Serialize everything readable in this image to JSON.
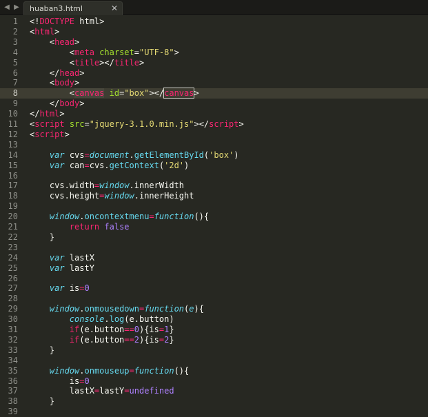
{
  "window": {
    "tab_title": "huaban3.html",
    "nav_back": "◀",
    "nav_forward": "▶",
    "close_glyph": "✕"
  },
  "editor": {
    "current_line": 8,
    "lines": [
      {
        "n": "1",
        "tokens": [
          [
            "t-plain",
            "<!"
          ],
          [
            "t-tag",
            "DOCTYPE"
          ],
          [
            "t-plain",
            " html>"
          ]
        ]
      },
      {
        "n": "2",
        "tokens": [
          [
            "t-plain",
            "<"
          ],
          [
            "t-tag",
            "html"
          ],
          [
            "t-plain",
            ">"
          ]
        ]
      },
      {
        "n": "3",
        "tokens": [
          [
            "t-plain",
            "    <"
          ],
          [
            "t-tag",
            "head"
          ],
          [
            "t-plain",
            ">"
          ]
        ]
      },
      {
        "n": "4",
        "tokens": [
          [
            "t-plain",
            "        <"
          ],
          [
            "t-tag",
            "meta"
          ],
          [
            "t-plain",
            " "
          ],
          [
            "t-attr",
            "charset"
          ],
          [
            "t-plain",
            "="
          ],
          [
            "t-str",
            "\"UTF-8\""
          ],
          [
            "t-plain",
            ">"
          ]
        ]
      },
      {
        "n": "5",
        "tokens": [
          [
            "t-plain",
            "        <"
          ],
          [
            "t-tag",
            "title"
          ],
          [
            "t-plain",
            "></"
          ],
          [
            "t-tag",
            "title"
          ],
          [
            "t-plain",
            ">"
          ]
        ]
      },
      {
        "n": "6",
        "tokens": [
          [
            "t-plain",
            "    </"
          ],
          [
            "t-tag",
            "head"
          ],
          [
            "t-plain",
            ">"
          ]
        ]
      },
      {
        "n": "7",
        "tokens": [
          [
            "t-plain",
            "    <"
          ],
          [
            "t-tag",
            "body"
          ],
          [
            "t-plain",
            ">"
          ]
        ]
      },
      {
        "n": "8",
        "tokens": [
          [
            "t-plain",
            "        <"
          ],
          [
            "t-tag boxfill",
            "canvas"
          ],
          [
            "t-plain",
            " "
          ],
          [
            "t-attr",
            "id"
          ],
          [
            "t-plain",
            "="
          ],
          [
            "t-str",
            "\"box\""
          ],
          [
            "t-plain",
            "></"
          ],
          [
            "t-tag box",
            "canvas"
          ],
          [
            "t-plain",
            ">"
          ]
        ]
      },
      {
        "n": "9",
        "tokens": [
          [
            "t-plain",
            "    </"
          ],
          [
            "t-tag",
            "body"
          ],
          [
            "t-plain",
            ">"
          ]
        ]
      },
      {
        "n": "10",
        "tokens": [
          [
            "t-plain",
            "</"
          ],
          [
            "t-tag",
            "html"
          ],
          [
            "t-plain",
            ">"
          ]
        ]
      },
      {
        "n": "11",
        "tokens": [
          [
            "t-plain",
            "<"
          ],
          [
            "t-tag",
            "script"
          ],
          [
            "t-plain",
            " "
          ],
          [
            "t-attr",
            "src"
          ],
          [
            "t-plain",
            "="
          ],
          [
            "t-str",
            "\"jquery-3.1.0.min.js\""
          ],
          [
            "t-plain",
            "></"
          ],
          [
            "t-tag",
            "script"
          ],
          [
            "t-plain",
            ">"
          ]
        ]
      },
      {
        "n": "12",
        "tokens": [
          [
            "t-plain",
            "<"
          ],
          [
            "t-tag",
            "script"
          ],
          [
            "t-plain",
            ">"
          ]
        ]
      },
      {
        "n": "13",
        "tokens": []
      },
      {
        "n": "14",
        "tokens": [
          [
            "t-plain",
            "    "
          ],
          [
            "t-kw",
            "var"
          ],
          [
            "t-plain",
            " cvs"
          ],
          [
            "t-op",
            "="
          ],
          [
            "t-kw",
            "document"
          ],
          [
            "t-plain",
            "."
          ],
          [
            "t-fn",
            "getElementById"
          ],
          [
            "t-plain",
            "("
          ],
          [
            "t-str",
            "'box'"
          ],
          [
            "t-plain",
            ")"
          ]
        ]
      },
      {
        "n": "15",
        "tokens": [
          [
            "t-plain",
            "    "
          ],
          [
            "t-kw",
            "var"
          ],
          [
            "t-plain",
            " can"
          ],
          [
            "t-op",
            "="
          ],
          [
            "t-plain",
            "cvs."
          ],
          [
            "t-fn",
            "getContext"
          ],
          [
            "t-plain",
            "("
          ],
          [
            "t-str",
            "'2d'"
          ],
          [
            "t-plain",
            ")"
          ]
        ]
      },
      {
        "n": "16",
        "tokens": []
      },
      {
        "n": "17",
        "tokens": [
          [
            "t-plain",
            "    cvs.width"
          ],
          [
            "t-op",
            "="
          ],
          [
            "t-kw",
            "window"
          ],
          [
            "t-plain",
            ".innerWidth"
          ]
        ]
      },
      {
        "n": "18",
        "tokens": [
          [
            "t-plain",
            "    cvs.height"
          ],
          [
            "t-op",
            "="
          ],
          [
            "t-kw",
            "window"
          ],
          [
            "t-plain",
            ".innerHeight"
          ]
        ]
      },
      {
        "n": "19",
        "tokens": []
      },
      {
        "n": "20",
        "tokens": [
          [
            "t-plain",
            "    "
          ],
          [
            "t-kw",
            "window"
          ],
          [
            "t-plain",
            "."
          ],
          [
            "t-fn",
            "oncontextmenu"
          ],
          [
            "t-op",
            "="
          ],
          [
            "t-kw",
            "function"
          ],
          [
            "t-plain",
            "(){"
          ]
        ]
      },
      {
        "n": "21",
        "tokens": [
          [
            "t-plain",
            "        "
          ],
          [
            "t-op",
            "return"
          ],
          [
            "t-plain",
            " "
          ],
          [
            "t-num",
            "false"
          ]
        ]
      },
      {
        "n": "22",
        "tokens": [
          [
            "t-plain",
            "    }"
          ]
        ]
      },
      {
        "n": "23",
        "tokens": []
      },
      {
        "n": "24",
        "tokens": [
          [
            "t-plain",
            "    "
          ],
          [
            "t-kw",
            "var"
          ],
          [
            "t-plain",
            " lastX"
          ]
        ]
      },
      {
        "n": "25",
        "tokens": [
          [
            "t-plain",
            "    "
          ],
          [
            "t-kw",
            "var"
          ],
          [
            "t-plain",
            " lastY"
          ]
        ]
      },
      {
        "n": "26",
        "tokens": []
      },
      {
        "n": "27",
        "tokens": [
          [
            "t-plain",
            "    "
          ],
          [
            "t-kw",
            "var"
          ],
          [
            "t-plain",
            " is"
          ],
          [
            "t-op",
            "="
          ],
          [
            "t-num",
            "0"
          ]
        ]
      },
      {
        "n": "28",
        "tokens": []
      },
      {
        "n": "29",
        "tokens": [
          [
            "t-plain",
            "    "
          ],
          [
            "t-kw",
            "window"
          ],
          [
            "t-plain",
            "."
          ],
          [
            "t-fn",
            "onmousedown"
          ],
          [
            "t-op",
            "="
          ],
          [
            "t-kw",
            "function"
          ],
          [
            "t-plain",
            "("
          ],
          [
            "t-kw",
            "e"
          ],
          [
            "t-plain",
            "){"
          ]
        ]
      },
      {
        "n": "30",
        "tokens": [
          [
            "t-plain",
            "        "
          ],
          [
            "t-kw",
            "console"
          ],
          [
            "t-plain",
            "."
          ],
          [
            "t-fn",
            "log"
          ],
          [
            "t-plain",
            "(e.button)"
          ]
        ]
      },
      {
        "n": "31",
        "tokens": [
          [
            "t-plain",
            "        "
          ],
          [
            "t-op",
            "if"
          ],
          [
            "t-plain",
            "(e.button"
          ],
          [
            "t-op",
            "=="
          ],
          [
            "t-num",
            "0"
          ],
          [
            "t-plain",
            "){is"
          ],
          [
            "t-op",
            "="
          ],
          [
            "t-num",
            "1"
          ],
          [
            "t-plain",
            "}"
          ]
        ]
      },
      {
        "n": "32",
        "tokens": [
          [
            "t-plain",
            "        "
          ],
          [
            "t-op",
            "if"
          ],
          [
            "t-plain",
            "(e.button"
          ],
          [
            "t-op",
            "=="
          ],
          [
            "t-num",
            "2"
          ],
          [
            "t-plain",
            "){is"
          ],
          [
            "t-op",
            "="
          ],
          [
            "t-num",
            "2"
          ],
          [
            "t-plain",
            "}"
          ]
        ]
      },
      {
        "n": "33",
        "tokens": [
          [
            "t-plain",
            "    }"
          ]
        ]
      },
      {
        "n": "34",
        "tokens": []
      },
      {
        "n": "35",
        "tokens": [
          [
            "t-plain",
            "    "
          ],
          [
            "t-kw",
            "window"
          ],
          [
            "t-plain",
            "."
          ],
          [
            "t-fn",
            "onmouseup"
          ],
          [
            "t-op",
            "="
          ],
          [
            "t-kw",
            "function"
          ],
          [
            "t-plain",
            "(){"
          ]
        ]
      },
      {
        "n": "36",
        "tokens": [
          [
            "t-plain",
            "        is"
          ],
          [
            "t-op",
            "="
          ],
          [
            "t-num",
            "0"
          ]
        ]
      },
      {
        "n": "37",
        "tokens": [
          [
            "t-plain",
            "        lastX"
          ],
          [
            "t-op",
            "="
          ],
          [
            "t-plain",
            "lastY"
          ],
          [
            "t-op",
            "="
          ],
          [
            "t-num",
            "undefined"
          ]
        ]
      },
      {
        "n": "38",
        "tokens": [
          [
            "t-plain",
            "    }"
          ]
        ]
      },
      {
        "n": "39",
        "tokens": []
      }
    ]
  }
}
